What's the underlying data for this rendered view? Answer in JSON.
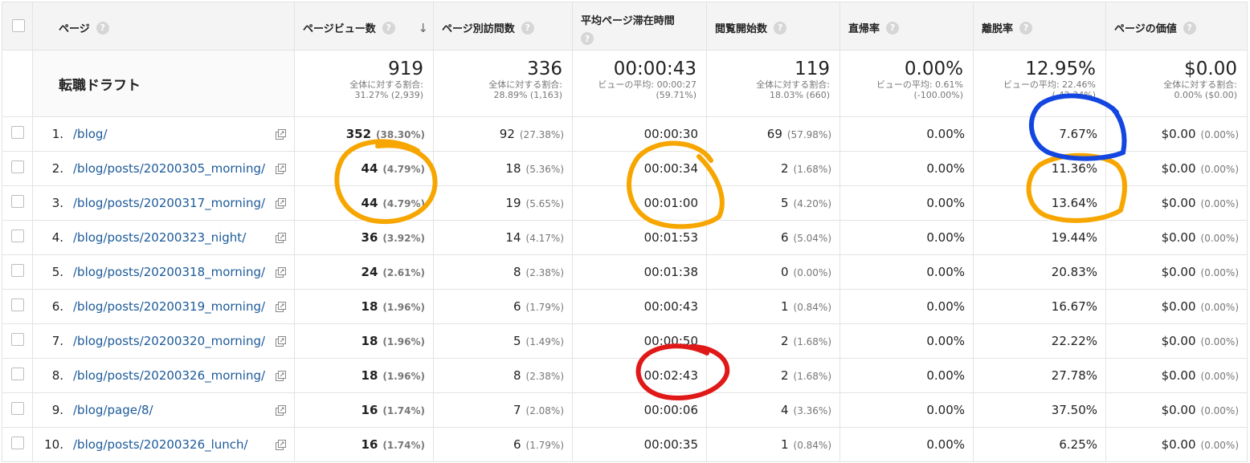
{
  "headers": [
    {
      "label": "ページ",
      "help": "?"
    },
    {
      "label": "ページビュー数",
      "help": "?",
      "sort": "↓"
    },
    {
      "label": "ページ別訪問数",
      "help": "?"
    },
    {
      "label": "平均ページ滞在時間",
      "help": "?"
    },
    {
      "label": "閲覧開始数",
      "help": "?"
    },
    {
      "label": "直帰率",
      "help": "?"
    },
    {
      "label": "離脱率",
      "help": "?"
    },
    {
      "label": "ページの価値",
      "help": "?"
    }
  ],
  "summary": {
    "title": "転職ドラフト",
    "metrics": [
      {
        "value": "919",
        "sub1": "全体に対する割合:",
        "sub2": "31.27% (2,939)"
      },
      {
        "value": "336",
        "sub1": "全体に対する割合:",
        "sub2": "28.89% (1,163)"
      },
      {
        "value": "00:00:43",
        "sub1": "ビューの平均: 00:00:27",
        "sub2": "(59.71%)"
      },
      {
        "value": "119",
        "sub1": "全体に対する割合:",
        "sub2": "18.03% (660)"
      },
      {
        "value": "0.00%",
        "sub1": "ビューの平均: 0.61%",
        "sub2": "(-100.00%)"
      },
      {
        "value": "12.95%",
        "sub1": "ビューの平均: 22.46%",
        "sub2": "(-42.34%)"
      },
      {
        "value": "$0.00",
        "sub1": "全体に対する割合:",
        "sub2": "0.00% ($0.00)"
      }
    ]
  },
  "rows": [
    {
      "idx": "1.",
      "page": "/blog/",
      "pv": "352",
      "pvp": "(38.30%)",
      "uv": "92",
      "uvp": "(27.38%)",
      "time": "00:00:30",
      "ent": "69",
      "entp": "(57.98%)",
      "bounce": "0.00%",
      "exit": "7.67%",
      "val": "$0.00",
      "valp": "(0.00%)"
    },
    {
      "idx": "2.",
      "page": "/blog/posts/20200305_morning/",
      "pv": "44",
      "pvp": "(4.79%)",
      "uv": "18",
      "uvp": "(5.36%)",
      "time": "00:00:34",
      "ent": "2",
      "entp": "(1.68%)",
      "bounce": "0.00%",
      "exit": "11.36%",
      "val": "$0.00",
      "valp": "(0.00%)"
    },
    {
      "idx": "3.",
      "page": "/blog/posts/20200317_morning/",
      "pv": "44",
      "pvp": "(4.79%)",
      "uv": "19",
      "uvp": "(5.65%)",
      "time": "00:01:00",
      "ent": "5",
      "entp": "(4.20%)",
      "bounce": "0.00%",
      "exit": "13.64%",
      "val": "$0.00",
      "valp": "(0.00%)"
    },
    {
      "idx": "4.",
      "page": "/blog/posts/20200323_night/",
      "pv": "36",
      "pvp": "(3.92%)",
      "uv": "14",
      "uvp": "(4.17%)",
      "time": "00:01:53",
      "ent": "6",
      "entp": "(5.04%)",
      "bounce": "0.00%",
      "exit": "19.44%",
      "val": "$0.00",
      "valp": "(0.00%)"
    },
    {
      "idx": "5.",
      "page": "/blog/posts/20200318_morning/",
      "pv": "24",
      "pvp": "(2.61%)",
      "uv": "8",
      "uvp": "(2.38%)",
      "time": "00:01:38",
      "ent": "0",
      "entp": "(0.00%)",
      "bounce": "0.00%",
      "exit": "20.83%",
      "val": "$0.00",
      "valp": "(0.00%)"
    },
    {
      "idx": "6.",
      "page": "/blog/posts/20200319_morning/",
      "pv": "18",
      "pvp": "(1.96%)",
      "uv": "6",
      "uvp": "(1.79%)",
      "time": "00:00:43",
      "ent": "1",
      "entp": "(0.84%)",
      "bounce": "0.00%",
      "exit": "16.67%",
      "val": "$0.00",
      "valp": "(0.00%)"
    },
    {
      "idx": "7.",
      "page": "/blog/posts/20200320_morning/",
      "pv": "18",
      "pvp": "(1.96%)",
      "uv": "5",
      "uvp": "(1.49%)",
      "time": "00:00:50",
      "ent": "2",
      "entp": "(1.68%)",
      "bounce": "0.00%",
      "exit": "22.22%",
      "val": "$0.00",
      "valp": "(0.00%)"
    },
    {
      "idx": "8.",
      "page": "/blog/posts/20200326_morning/",
      "pv": "18",
      "pvp": "(1.96%)",
      "uv": "8",
      "uvp": "(2.38%)",
      "time": "00:02:43",
      "ent": "2",
      "entp": "(1.68%)",
      "bounce": "0.00%",
      "exit": "27.78%",
      "val": "$0.00",
      "valp": "(0.00%)"
    },
    {
      "idx": "9.",
      "page": "/blog/page/8/",
      "pv": "16",
      "pvp": "(1.74%)",
      "uv": "7",
      "uvp": "(2.08%)",
      "time": "00:00:06",
      "ent": "4",
      "entp": "(3.36%)",
      "bounce": "0.00%",
      "exit": "37.50%",
      "val": "$0.00",
      "valp": "(0.00%)"
    },
    {
      "idx": "10.",
      "page": "/blog/posts/20200326_lunch/",
      "pv": "16",
      "pvp": "(1.74%)",
      "uv": "6",
      "uvp": "(1.79%)",
      "time": "00:00:35",
      "ent": "1",
      "entp": "(0.84%)",
      "bounce": "0.00%",
      "exit": "6.25%",
      "val": "$0.00",
      "valp": "(0.00%)"
    }
  ],
  "colors": {
    "orange": "#f7a600",
    "blue": "#1346e0",
    "red": "#e01818",
    "link": "#1c5a99"
  },
  "icons": {
    "external": "open-in-new-window-icon",
    "help": "help-circle-icon",
    "sort": "sort-desc-arrow-icon"
  }
}
